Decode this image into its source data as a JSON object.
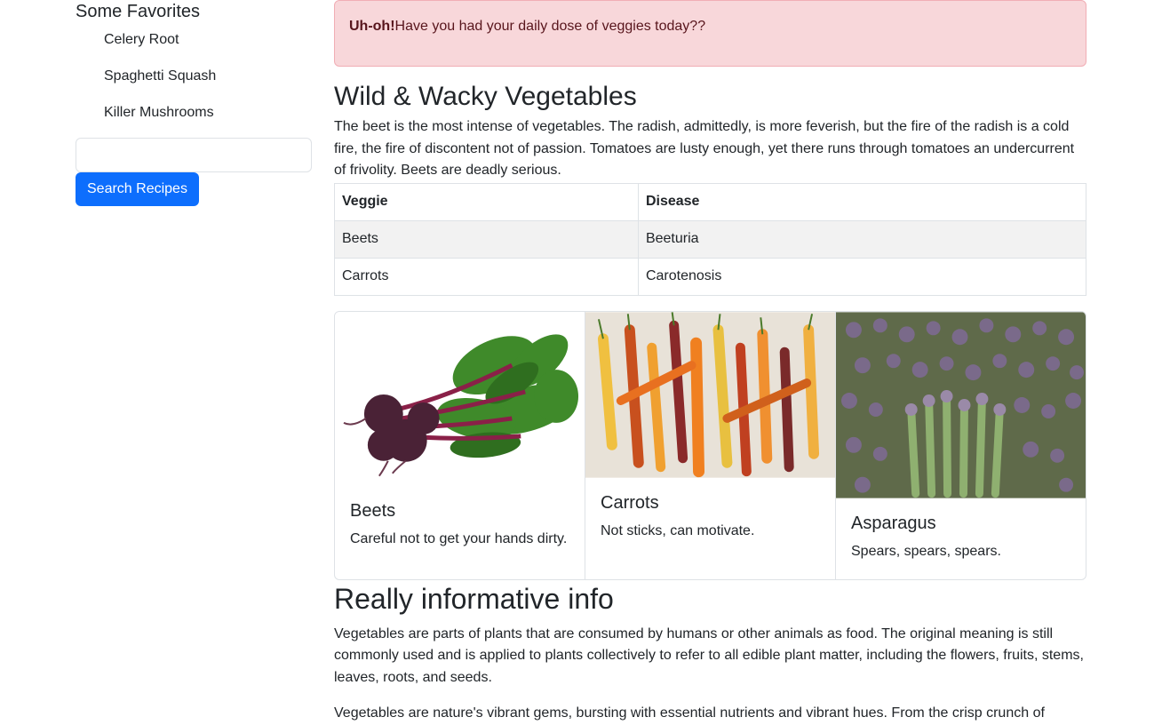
{
  "sidebar": {
    "title": "Some Favorites",
    "favorites": [
      "Celery Root",
      "Spaghetti Squash",
      "Killer Mushrooms"
    ],
    "search_placeholder": "",
    "search_button": "Search Recipes"
  },
  "alert": {
    "strong": "Uh-oh!",
    "text": "Have you had your daily dose of veggies today??"
  },
  "section1": {
    "heading": "Wild & Wacky Vegetables",
    "paragraph": "The beet is the most intense of vegetables. The radish, admittedly, is more feverish, but the fire of the radish is a cold fire, the fire of discontent not of passion. Tomatoes are lusty enough, yet there runs through tomatoes an undercurrent of frivolity. Beets are deadly serious."
  },
  "table": {
    "headers": [
      "Veggie",
      "Disease"
    ],
    "rows": [
      [
        "Beets",
        "Beeturia"
      ],
      [
        "Carrots",
        "Carotenosis"
      ]
    ]
  },
  "cards": [
    {
      "title": "Beets",
      "text": "Careful not to get your hands dirty."
    },
    {
      "title": "Carrots",
      "text": "Not sticks, can motivate."
    },
    {
      "title": "Asparagus",
      "text": "Spears, spears, spears."
    }
  ],
  "section2": {
    "heading": "Really informative info",
    "paragraph1": "Vegetables are parts of plants that are consumed by humans or other animals as food. The original meaning is still commonly used and is applied to plants collectively to refer to all edible plant matter, including the flowers, fruits, stems, leaves, roots, and seeds.",
    "paragraph2": "Vegetables are nature's vibrant gems, bursting with essential nutrients and vibrant hues. From the crisp crunch of"
  },
  "colors": {
    "primary": "#0d6efd",
    "alert_bg": "#f8d7da",
    "alert_border": "#f1aeb5",
    "alert_text": "#58151c"
  }
}
